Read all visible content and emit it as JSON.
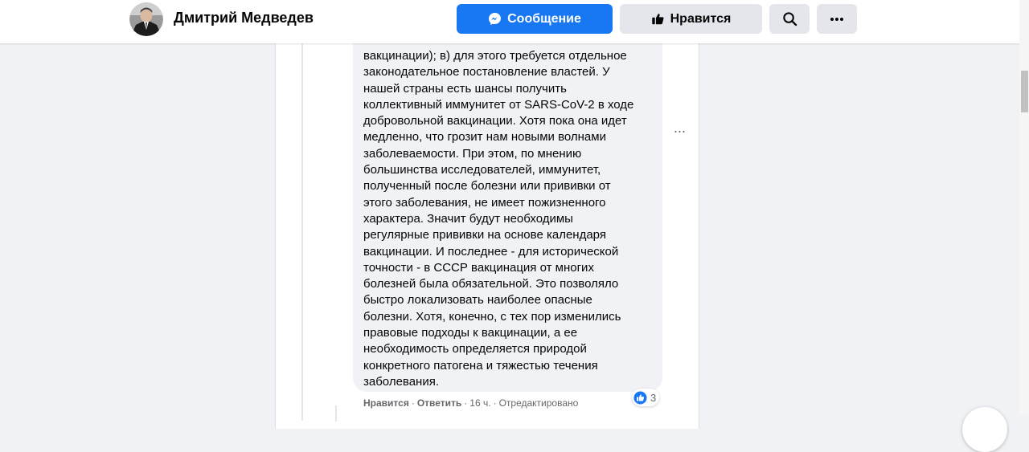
{
  "header": {
    "page_name": "Дмитрий Медведев",
    "message_label": "Сообщение",
    "like_label": "Нравится"
  },
  "comment": {
    "text": "вакцинации); в) для этого требуется отдельное\nзаконодательное постановление властей. У\nнашей страны есть шансы получить\nколлективный иммунитет от SARS-CoV-2 в ходе\nдобровольной вакцинации. Хотя пока она идет\nмедленно, что грозит нам новыми волнами\nзаболеваемости. При этом, по мнению\nбольшинства исследователей, иммунитет,\nполученный после болезни или прививки от\nэтого заболевания, не имеет пожизненного\nхарактера. Значит будут необходимы\nрегулярные прививки на основе календаря\nвакцинации. И последнее - для исторической\nточности - в СССР вакцинация от многих\nболезней была обязательной. Это позволяло\nбыстро локализовать наиболее опасные\nболезни. Хотя, конечно, с тех пор изменились\nправовые подходы к вакцинации, а ее\nнеобходимость определяется природой\nконкретного патогена и тяжестью течения\nзаболевания.",
    "like_action": "Нравится",
    "reply_action": "Ответить",
    "separator": "·",
    "time": "16 ч.",
    "edited": "Отредактировано",
    "reaction_count": "3"
  },
  "colors": {
    "accent": "#1877f2",
    "secondary_button": "#e4e6eb",
    "bubble": "#f0f2f5",
    "meta_text": "#65676b"
  },
  "icons": {
    "messenger": "messenger-icon",
    "like": "thumbs-up-icon",
    "search": "search-icon",
    "more": "more-horizontal-icon"
  }
}
